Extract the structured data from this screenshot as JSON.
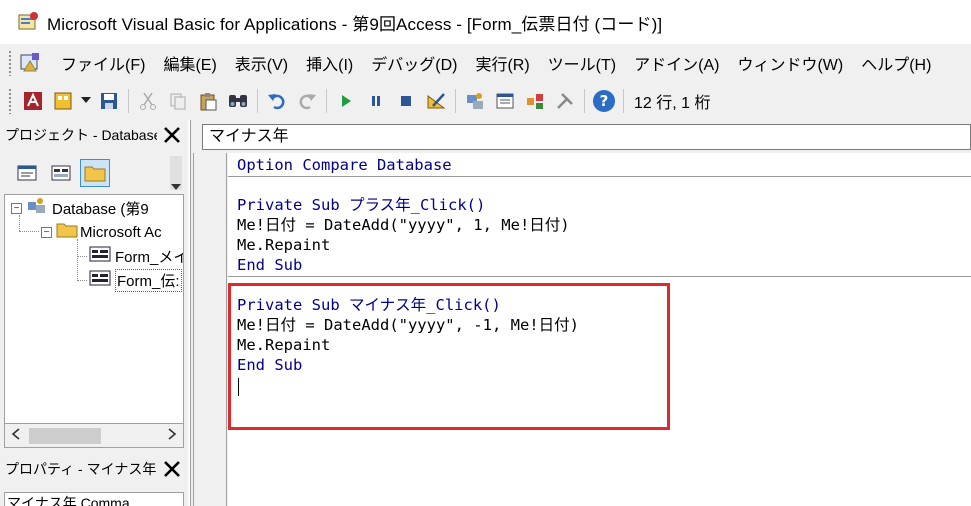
{
  "window": {
    "title": "Microsoft Visual Basic for Applications - 第9回Access - [Form_伝票日付 (コード)]"
  },
  "menubar": {
    "items": [
      "ファイル(F)",
      "編集(E)",
      "表示(V)",
      "挿入(I)",
      "デバッグ(D)",
      "実行(R)",
      "ツール(T)",
      "アドイン(A)",
      "ウィンドウ(W)",
      "ヘルプ(H)"
    ]
  },
  "toolbar": {
    "position_text": "12 行, 1 桁"
  },
  "project_pane": {
    "title": "プロジェクト - Database",
    "tree": [
      {
        "label": "Database (第9",
        "level": 0,
        "expander": "−"
      },
      {
        "label": "Microsoft Ac",
        "level": 1,
        "expander": "−"
      },
      {
        "label": "Form_メイ",
        "level": 2
      },
      {
        "label": "Form_伝:",
        "level": 2
      }
    ]
  },
  "properties_pane": {
    "title": "プロパティ - マイナス年",
    "field_value": "マイナス年 Comma"
  },
  "code_window": {
    "procedure_dropdown": "マイナス年",
    "lines": {
      "l1": "Option Compare Database",
      "l2": "Private Sub プラス年_Click()",
      "l3": "Me!日付 = DateAdd(\"yyyy\", 1, Me!日付)",
      "l4": "Me.Repaint",
      "l5": "End Sub",
      "l6": "Private Sub マイナス年_Click()",
      "l7": "Me!日付 = DateAdd(\"yyyy\", -1, Me!日付)",
      "l8": "Me.Repaint",
      "l9": "End Sub"
    }
  },
  "colors": {
    "keyword": "#00008b",
    "highlight_border": "#e0292b"
  }
}
